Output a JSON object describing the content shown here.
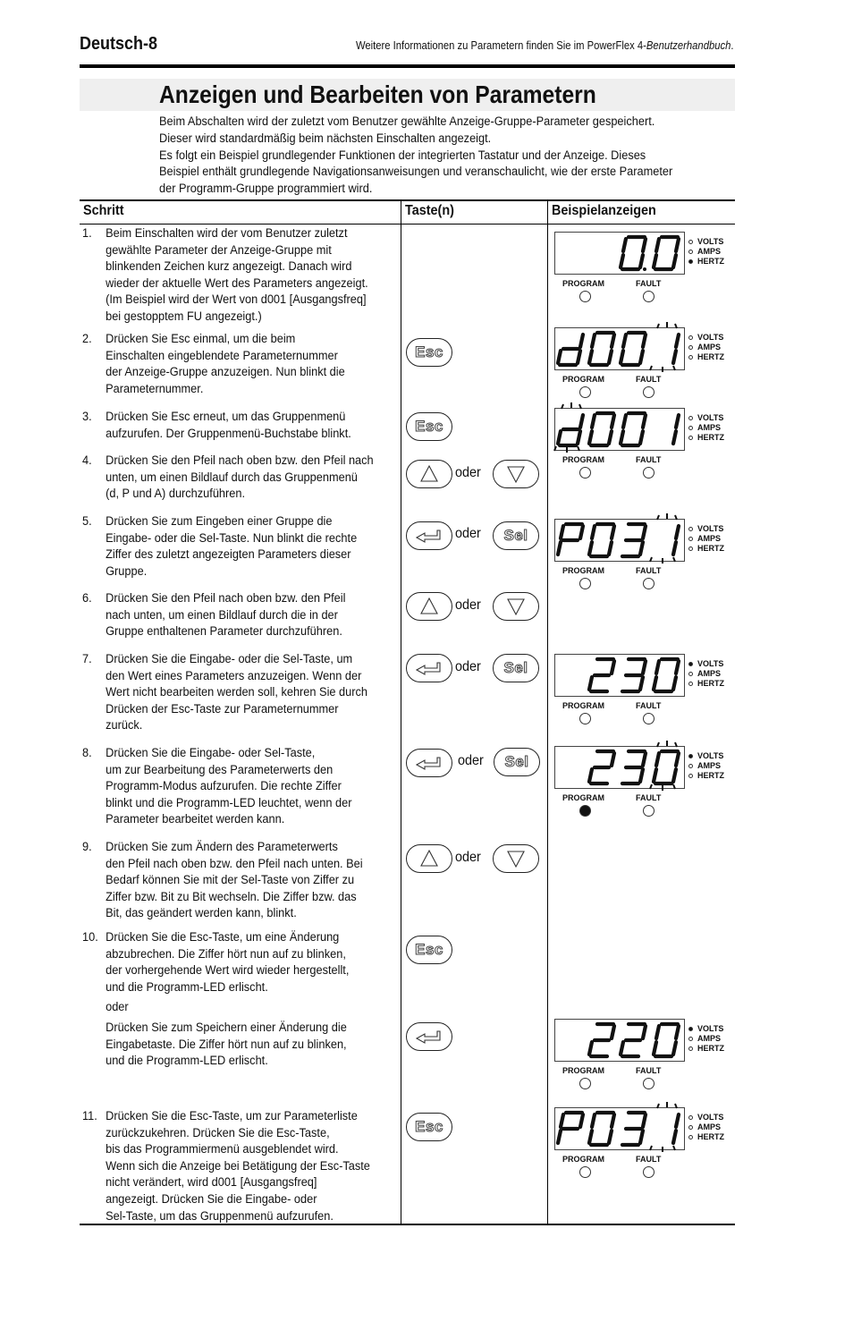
{
  "header": {
    "page_label": "Deutsch-8",
    "reference_text": "Weitere Informationen zu Parametern finden Sie im PowerFlex 4-",
    "reference_italic": "Benutzerhandbuch",
    "reference_end": "."
  },
  "title": "Anzeigen und Bearbeiten von Parametern",
  "intro": [
    "Beim Abschalten wird der zuletzt vom Benutzer gewählte Anzeige-Gruppe-Parameter gespeichert.",
    "Dieser wird standardmäßig beim nächsten Einschalten angezeigt.",
    "Es folgt ein Beispiel grundlegender Funktionen der integrierten Tastatur und der Anzeige. Dieses",
    "Beispiel enthält grundlegende Navigationsanweisungen und veranschaulicht, wie der erste Parameter",
    "der Programm-Gruppe programmiert wird."
  ],
  "table": {
    "columns": [
      "Schritt",
      "Taste(n)",
      "Beispielanzeigen"
    ],
    "steps": [
      {
        "num": "1.",
        "lines": [
          "Beim Einschalten wird der vom Benutzer zuletzt",
          "gewählte Parameter der Anzeige-Gruppe mit",
          "blinkenden Zeichen kurz angezeigt. Danach wird",
          "wieder der aktuelle Wert des Parameters angezeigt.",
          "(Im Beispiel wird der Wert von d001 [Ausgangsfreq]",
          "bei gestopptem FU angezeigt.)"
        ]
      },
      {
        "num": "2.",
        "lines": [
          "Drücken Sie Esc einmal, um die beim",
          "Einschalten eingeblendete Parameternummer",
          "der Anzeige-Gruppe anzuzeigen. Nun blinkt die",
          "Parameternummer."
        ]
      },
      {
        "num": "3.",
        "lines": [
          "Drücken Sie Esc erneut, um das Gruppenmenü",
          "aufzurufen. Der Gruppenmenü-Buchstabe blinkt."
        ]
      },
      {
        "num": "4.",
        "lines": [
          "Drücken Sie den Pfeil nach oben bzw. den Pfeil nach",
          "unten, um einen Bildlauf durch das Gruppenmenü",
          "(d, P und A) durchzuführen."
        ]
      },
      {
        "num": "5.",
        "lines": [
          "Drücken Sie zum Eingeben einer Gruppe die",
          "Eingabe- oder die Sel-Taste. Nun blinkt die rechte",
          "Ziffer des zuletzt angezeigten Parameters dieser",
          "Gruppe."
        ]
      },
      {
        "num": "6.",
        "lines": [
          "Drücken Sie den Pfeil nach oben bzw. den Pfeil",
          "nach unten, um einen Bildlauf durch die in der",
          "Gruppe enthaltenen Parameter durchzuführen."
        ]
      },
      {
        "num": "7.",
        "lines": [
          "Drücken Sie die Eingabe- oder die Sel-Taste, um",
          "den Wert eines Parameters anzuzeigen. Wenn der",
          "Wert nicht bearbeiten werden soll, kehren Sie durch",
          "Drücken der Esc-Taste zur Parameternummer",
          "zurück."
        ]
      },
      {
        "num": "8.",
        "lines": [
          "Drücken Sie die Eingabe- oder Sel-Taste,",
          "um zur Bearbeitung des Parameterwerts den",
          "Programm-Modus aufzurufen. Die rechte Ziffer",
          "blinkt und die Programm-LED leuchtet, wenn der",
          "Parameter bearbeitet werden kann."
        ]
      },
      {
        "num": "9.",
        "lines": [
          "Drücken Sie zum Ändern des Parameterwerts",
          "den Pfeil nach oben bzw. den Pfeil nach unten. Bei",
          "Bedarf können Sie mit der Sel-Taste von Ziffer zu",
          "Ziffer bzw. Bit zu Bit wechseln. Die Ziffer bzw. das",
          "Bit, das geändert werden kann, blinkt."
        ]
      },
      {
        "num": "10.",
        "lines": [
          "Drücken Sie die Esc-Taste, um eine Änderung",
          "abzubrechen. Die Ziffer hört nun auf zu blinken,",
          "der vorhergehende Wert wird wieder hergestellt,",
          "und die Programm-LED erlischt."
        ]
      },
      {
        "num": "",
        "lines": [
          "oder"
        ]
      },
      {
        "num": "",
        "lines": [
          "Drücken Sie zum Speichern einer Änderung die",
          "Eingabetaste. Die Ziffer hört nun auf zu blinken,",
          "und die Programm-LED erlischt."
        ]
      },
      {
        "num": "11.",
        "lines": [
          "Drücken Sie die Esc-Taste, um zur Parameterliste",
          "zurückzukehren. Drücken Sie die Esc-Taste,",
          "bis das Programmiermenü ausgeblendet wird.",
          "Wenn sich die Anzeige bei Betätigung der Esc-Taste",
          "nicht verändert, wird d001 [Ausgangsfreq]",
          "angezeigt. Drücken Sie die Eingabe- oder",
          "Sel-Taste, um das Gruppenmenü aufzurufen."
        ]
      }
    ]
  },
  "keys": {
    "esc": "Esc",
    "sel": "Sel",
    "or": "oder"
  },
  "display_labels": {
    "volts": "VOLTS",
    "amps": "AMPS",
    "hertz": "HERTZ",
    "program": "PROGRAM",
    "fault": "FAULT"
  },
  "displays": [
    {
      "text": "0.0",
      "unit": "hertz",
      "program_led": false,
      "blink": null
    },
    {
      "text": "d001",
      "unit": null,
      "program_led": false,
      "blink": 3
    },
    {
      "text": "d001",
      "unit": null,
      "program_led": false,
      "blink": 0
    },
    {
      "text": "P031",
      "unit": null,
      "program_led": false,
      "blink": 3
    },
    {
      "text": "230",
      "unit": "volts",
      "program_led": false,
      "blink": null
    },
    {
      "text": "230",
      "unit": "volts",
      "program_led": true,
      "blink": 3
    },
    {
      "text": "220",
      "unit": "volts",
      "program_led": false,
      "blink": null
    },
    {
      "text": "P031",
      "unit": null,
      "program_led": false,
      "blink": 3
    }
  ]
}
